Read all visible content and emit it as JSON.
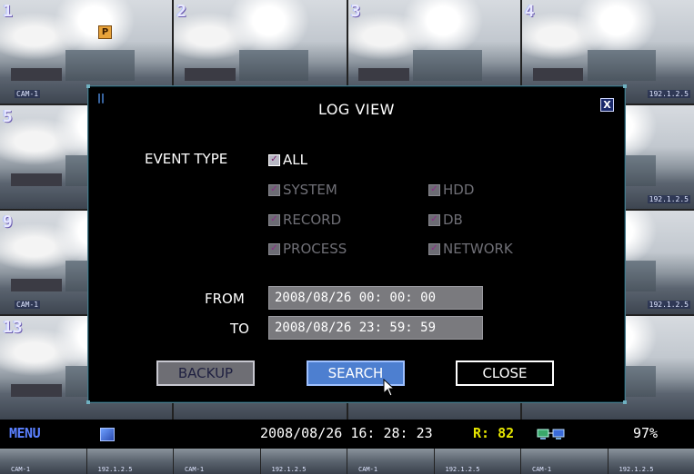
{
  "cameras": [
    {
      "num": "1",
      "tag": "CAM-1"
    },
    {
      "num": "2",
      "tag": ""
    },
    {
      "num": "3",
      "tag": ""
    },
    {
      "num": "4",
      "tag": "192.1.2.5"
    },
    {
      "num": "5",
      "tag": ""
    },
    {
      "num": "",
      "tag": ""
    },
    {
      "num": "",
      "tag": ""
    },
    {
      "num": "",
      "tag": "192.1.2.5"
    },
    {
      "num": "9",
      "tag": "CAM-1"
    },
    {
      "num": "",
      "tag": ""
    },
    {
      "num": "",
      "tag": ""
    },
    {
      "num": "",
      "tag": "192.1.2.5"
    },
    {
      "num": "13",
      "tag": ""
    },
    {
      "num": "",
      "tag": ""
    },
    {
      "num": "",
      "tag": ""
    },
    {
      "num": "",
      "tag": ""
    }
  ],
  "p_badge": "P",
  "dialog": {
    "title": "LOG VIEW",
    "grip": "||",
    "close_glyph": "X",
    "event_type_label": "EVENT TYPE",
    "event_types": {
      "all": "ALL",
      "system": "SYSTEM",
      "hdd": "HDD",
      "record": "RECORD",
      "db": "DB",
      "process": "PROCESS",
      "network": "NETWORK"
    },
    "from_label": "FROM",
    "from_value": "2008/08/26  00: 00: 00",
    "to_label": "TO",
    "to_value": "2008/08/26  23: 59: 59",
    "backup_label": "BACKUP",
    "search_label": "SEARCH",
    "close_label": "CLOSE"
  },
  "statusbar": {
    "menu_label": "MENU",
    "datetime": "2008/08/26  16: 28: 23",
    "rec_label": "R: 82",
    "disk_usage": "97%"
  },
  "bottom_strip": [
    "CAM-1",
    "192.1.2.5",
    "CAM-1",
    "192.1.2.5",
    "CAM-1",
    "192.1.2.5",
    "CAM-1",
    "192.1.2.5"
  ],
  "colors": {
    "accent": "#4d7fd0",
    "dialog_bg": "#000000",
    "rec_yellow": "#e6e600"
  },
  "icons": {
    "dialog_close": "close-icon",
    "menu_icon": "camera-icon",
    "network": "network-icon",
    "cursor": "mouse-pointer-icon"
  }
}
